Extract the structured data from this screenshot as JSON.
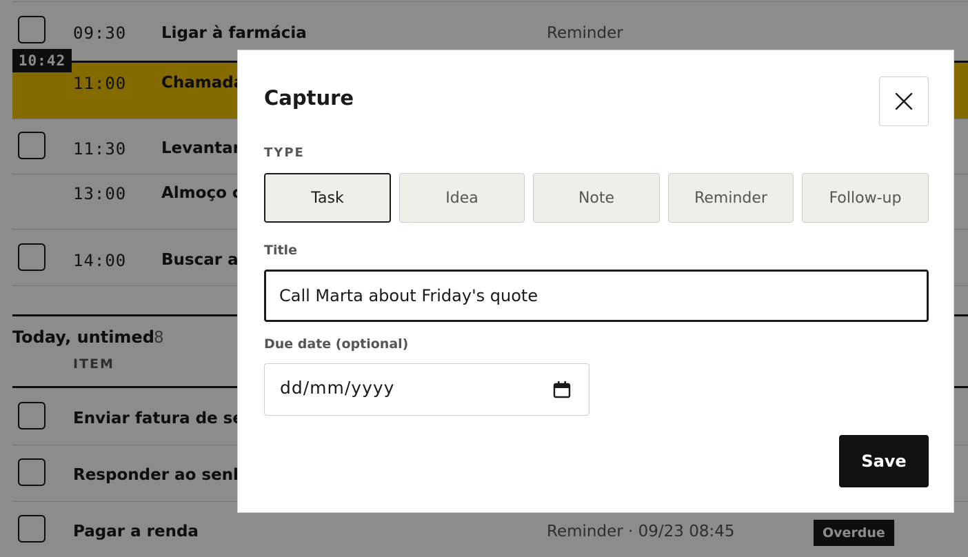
{
  "now_time": "10:42",
  "timed_items": [
    {
      "time": "09:30",
      "title": "Ligar à farmácia",
      "type": "Reminder"
    },
    {
      "time": "11:00",
      "title": "Chamada"
    },
    {
      "time": "11:30",
      "title": "Levantar"
    },
    {
      "time": "13:00",
      "title": "Almoço c"
    },
    {
      "time": "14:00",
      "title": "Buscar a"
    }
  ],
  "untimed": {
    "heading": "Today, untimed",
    "count": "8",
    "column_header": "ITEM",
    "items": [
      {
        "title": "Enviar fatura de set"
      },
      {
        "title": "Responder ao senho"
      },
      {
        "title": "Pagar a renda",
        "meta": "Reminder · 09/23 08:45",
        "badge": "Overdue"
      }
    ]
  },
  "modal": {
    "title": "Capture",
    "type_label": "TYPE",
    "types": [
      "Task",
      "Idea",
      "Note",
      "Reminder",
      "Follow-up"
    ],
    "selected_type": "Task",
    "title_label": "Title",
    "title_value": "Call Marta about Friday's quote",
    "due_label": "Due date (optional)",
    "due_placeholder": "dd/mm/yyyy",
    "save_label": "Save"
  },
  "colors": {
    "current_highlight": "#f2c200",
    "ink": "#1a1a1a",
    "chip_bg": "#efefea"
  },
  "icons": {
    "close": "close-icon",
    "calendar": "calendar-icon"
  }
}
